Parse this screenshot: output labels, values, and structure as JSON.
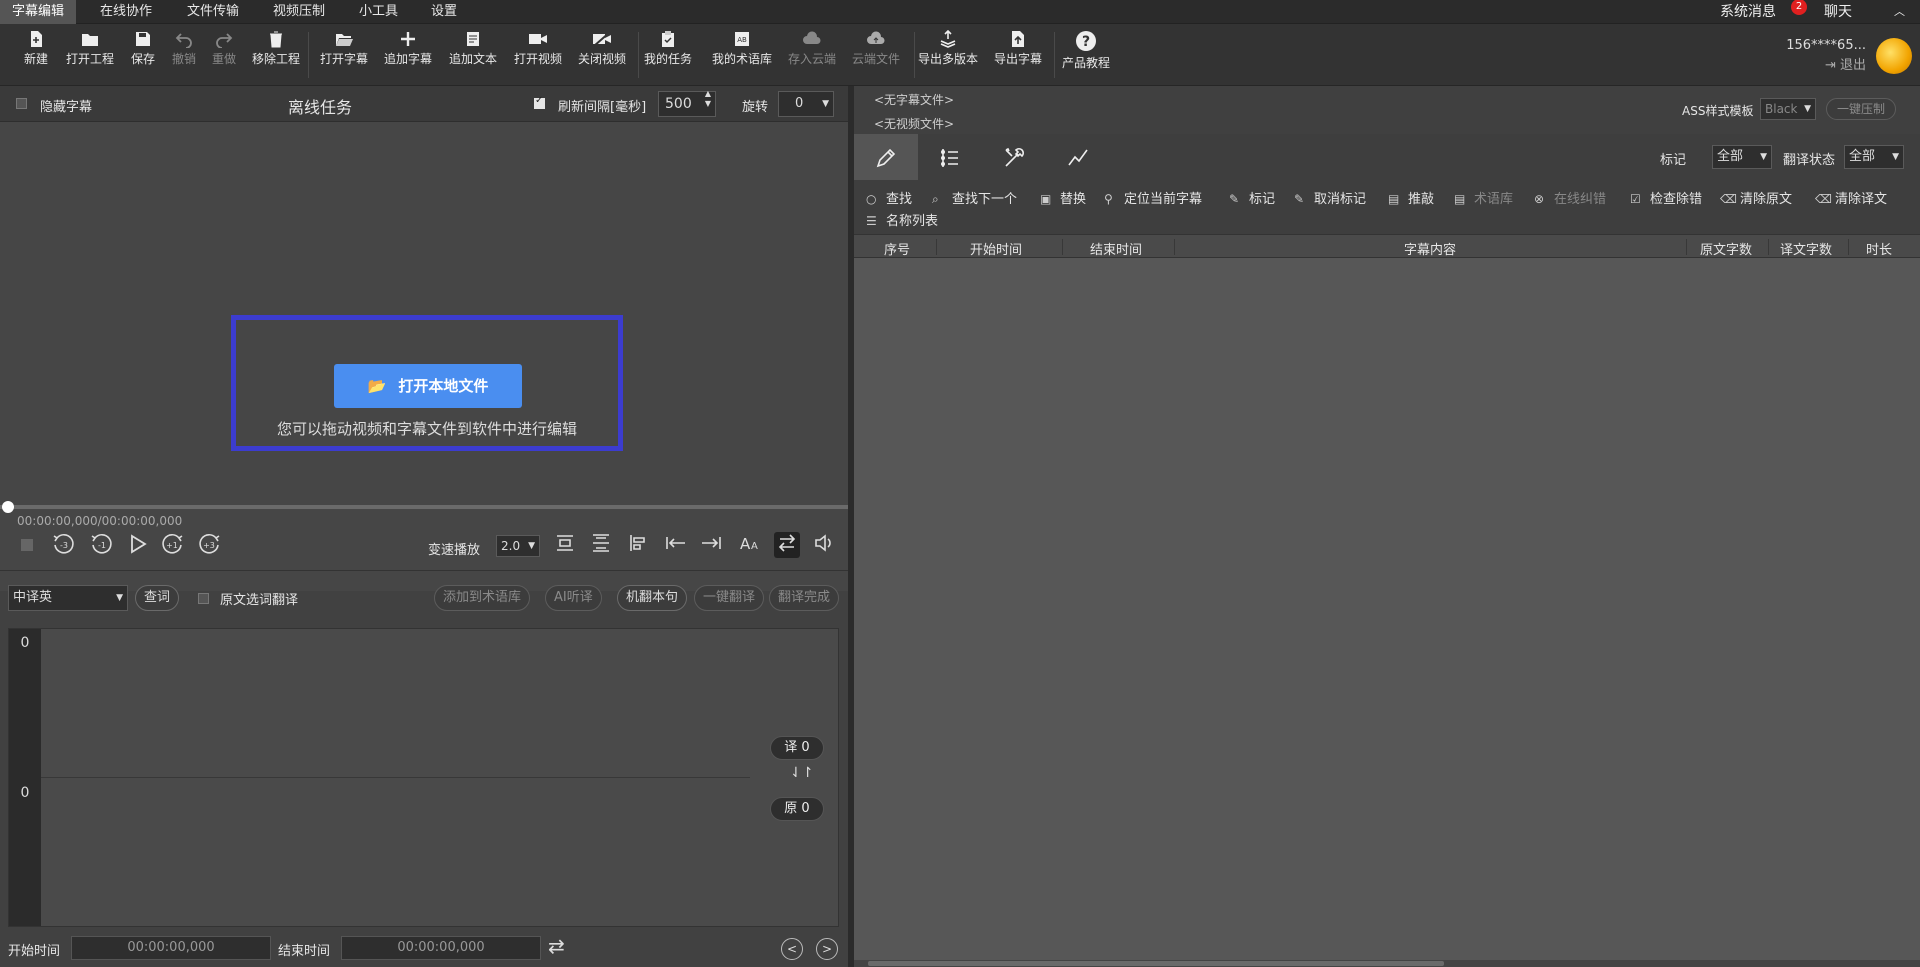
{
  "menu": {
    "items": [
      "字幕编辑",
      "在线协作",
      "文件传输",
      "视频压制",
      "小工具",
      "设置"
    ],
    "system_msg": "系统消息",
    "badge_count": "2",
    "chat": "聊天"
  },
  "toolbar": {
    "items": [
      {
        "label": "新建",
        "icon": "new-file-icon"
      },
      {
        "label": "打开工程",
        "icon": "folder-icon"
      },
      {
        "label": "保存",
        "icon": "save-icon"
      },
      {
        "label": "撤销",
        "icon": "undo-icon"
      },
      {
        "label": "重做",
        "icon": "redo-icon"
      },
      {
        "label": "移除工程",
        "icon": "trash-icon"
      },
      {
        "label": "打开字幕",
        "icon": "folder-open-icon"
      },
      {
        "label": "追加字幕",
        "icon": "plus-icon"
      },
      {
        "label": "追加文本",
        "icon": "text-doc-icon"
      },
      {
        "label": "打开视频",
        "icon": "video-camera-icon"
      },
      {
        "label": "关闭视频",
        "icon": "video-off-icon"
      },
      {
        "label": "我的任务",
        "icon": "clipboard-icon"
      },
      {
        "label": "我的术语库",
        "icon": "glossary-icon"
      },
      {
        "label": "存入云端",
        "icon": "cloud-upload-icon"
      },
      {
        "label": "云端文件",
        "icon": "cloud-file-icon"
      },
      {
        "label": "导出多版本",
        "icon": "export-multi-icon"
      },
      {
        "label": "导出字幕",
        "icon": "export-file-icon"
      },
      {
        "label": "产品教程",
        "icon": "help-icon"
      }
    ],
    "user_id": "156****65...",
    "logout": "退出"
  },
  "left": {
    "hide_subtitle": "隐藏字幕",
    "title": "离线任务",
    "refresh_label": "刷新间隔[毫秒]",
    "refresh_value": "500",
    "rotate_label": "旋转",
    "rotate_value": "0",
    "open_local": "打开本地文件",
    "drop_hint": "您可以拖动视频和字幕文件到软件中进行编辑",
    "timecode": "00:00:00,000/00:00:00,000",
    "speed_label": "变速播放",
    "speed_value": "2.0",
    "lang_value": "中译英",
    "lookup": "查词",
    "source_select_translate": "原文选词翻译",
    "add_glossary": "添加到术语库",
    "ai_listen": "AI听译",
    "machine_translate": "机翻本句",
    "one_click_translate": "一键翻译",
    "translate_done": "翻译完成",
    "line_top": "0",
    "line_bottom": "0",
    "trans_count": "译 0",
    "orig_count": "原 0",
    "start_label": "开始时间",
    "start_value": "00:00:00,000",
    "end_label": "结束时间",
    "end_value": "00:00:00,000"
  },
  "right": {
    "no_subtitle": "<无字幕文件>",
    "no_video": "<无视频文件>",
    "ass_label": "ASS样式模板",
    "ass_value": "Black",
    "one_click_burn": "一键压制",
    "mark_label": "标记",
    "mark_value": "全部",
    "trans_status_label": "翻译状态",
    "trans_status_value": "全部",
    "actions": [
      "查找",
      "查找下一个",
      "替换",
      "定位当前字幕",
      "标记",
      "取消标记",
      "推敲",
      "术语库",
      "在线纠错",
      "检查除错",
      "清除原文",
      "清除译文",
      "名称列表"
    ],
    "columns": [
      "序号",
      "开始时间",
      "结束时间",
      "字幕内容",
      "原文字数",
      "译文字数",
      "时长"
    ]
  }
}
